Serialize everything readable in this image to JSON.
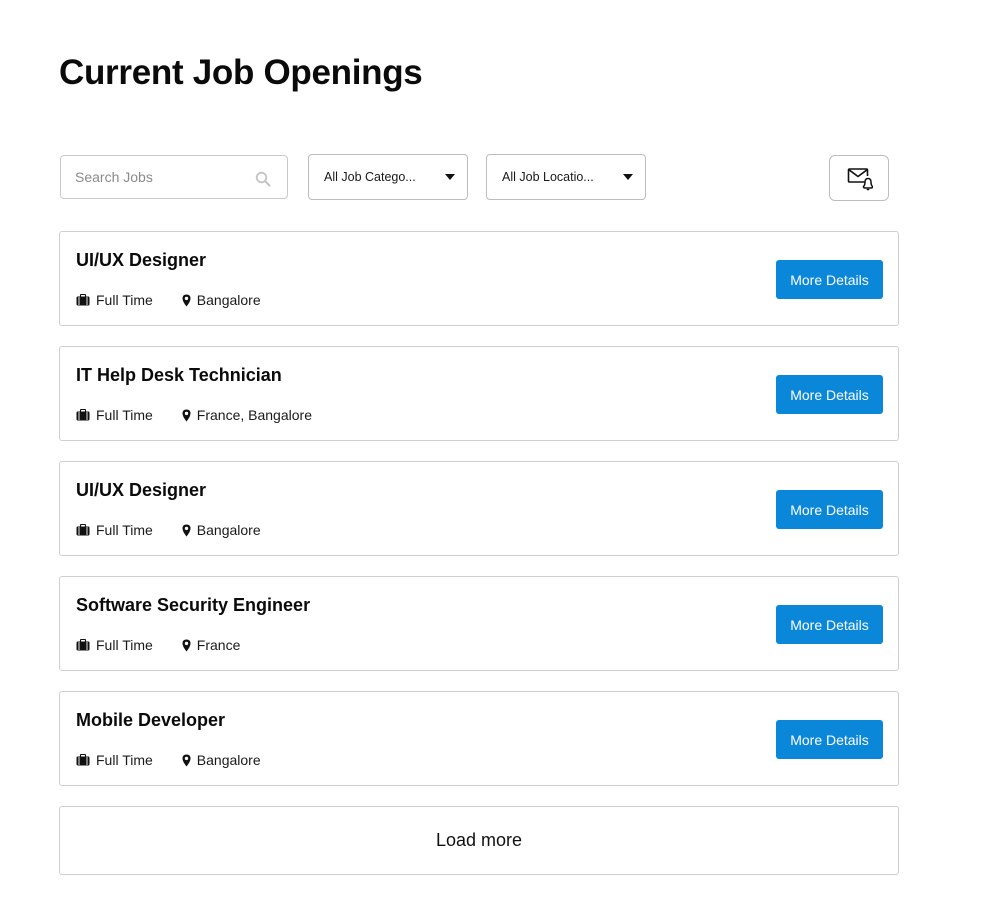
{
  "header": {
    "title": "Current Job Openings"
  },
  "filters": {
    "search": {
      "placeholder": "Search Jobs",
      "value": ""
    },
    "category": {
      "selected": "All Job Catego..."
    },
    "location": {
      "selected": "All Job Locatio..."
    },
    "alert_icon": "mail-bell-icon"
  },
  "jobs": [
    {
      "title": "UI/UX Designer",
      "type": "Full Time",
      "location": "Bangalore",
      "button": "More Details"
    },
    {
      "title": "IT Help Desk Technician",
      "type": "Full Time",
      "location": "France, Bangalore",
      "button": "More Details"
    },
    {
      "title": "UI/UX Designer",
      "type": "Full Time",
      "location": "Bangalore",
      "button": "More Details"
    },
    {
      "title": "Software Security Engineer",
      "type": "Full Time",
      "location": "France",
      "button": "More Details"
    },
    {
      "title": "Mobile Developer",
      "type": "Full Time",
      "location": "Bangalore",
      "button": "More Details"
    }
  ],
  "load_more_label": "Load more",
  "colors": {
    "accent": "#0b87da",
    "border": "#cfcfcf",
    "text": "#111111"
  }
}
